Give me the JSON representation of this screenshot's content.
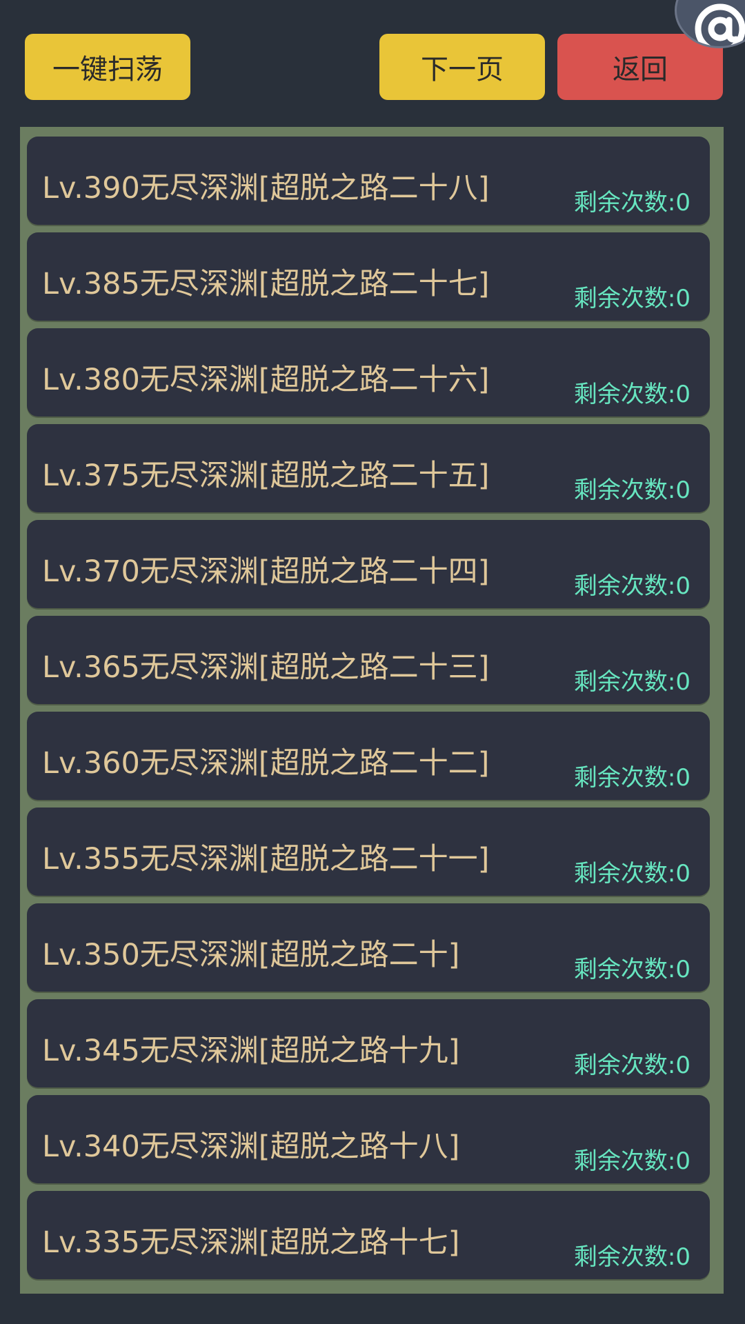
{
  "toolbar": {
    "sweep_label": "一键扫荡",
    "next_label": "下一页",
    "back_label": "返回"
  },
  "colors": {
    "background": "#29303a",
    "button_yellow": "#e9c538",
    "button_red": "#d9534f",
    "panel_border": "#6b7d60",
    "item_bg": "#2e3240",
    "title_text": "#e0c89a",
    "count_text": "#67e6c0"
  },
  "avatar_icon": "at-sign-icon",
  "levels": [
    {
      "title": "Lv.390无尽深渊[超脱之路二十八]",
      "remaining": "剩余次数:0"
    },
    {
      "title": "Lv.385无尽深渊[超脱之路二十七]",
      "remaining": "剩余次数:0"
    },
    {
      "title": "Lv.380无尽深渊[超脱之路二十六]",
      "remaining": "剩余次数:0"
    },
    {
      "title": "Lv.375无尽深渊[超脱之路二十五]",
      "remaining": "剩余次数:0"
    },
    {
      "title": "Lv.370无尽深渊[超脱之路二十四]",
      "remaining": "剩余次数:0"
    },
    {
      "title": "Lv.365无尽深渊[超脱之路二十三]",
      "remaining": "剩余次数:0"
    },
    {
      "title": "Lv.360无尽深渊[超脱之路二十二]",
      "remaining": "剩余次数:0"
    },
    {
      "title": "Lv.355无尽深渊[超脱之路二十一]",
      "remaining": "剩余次数:0"
    },
    {
      "title": "Lv.350无尽深渊[超脱之路二十]",
      "remaining": "剩余次数:0"
    },
    {
      "title": "Lv.345无尽深渊[超脱之路十九]",
      "remaining": "剩余次数:0"
    },
    {
      "title": "Lv.340无尽深渊[超脱之路十八]",
      "remaining": "剩余次数:0"
    },
    {
      "title": "Lv.335无尽深渊[超脱之路十七]",
      "remaining": "剩余次数:0"
    }
  ]
}
